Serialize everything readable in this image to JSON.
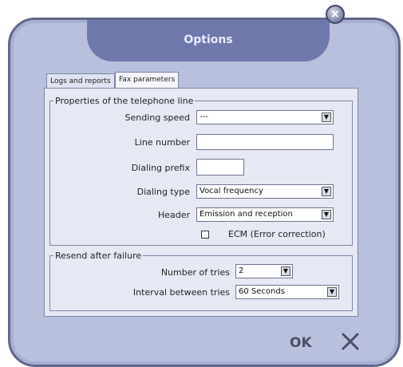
{
  "window": {
    "title": "Options",
    "close_icon": "close-icon"
  },
  "tabs": [
    {
      "label": "Logs and reports"
    },
    {
      "label": "Fax parameters",
      "active": true
    }
  ],
  "telephone_line": {
    "legend": "Properties of the telephone line",
    "sending_speed": {
      "label": "Sending speed",
      "value": "---"
    },
    "line_number": {
      "label": "Line number",
      "value": ""
    },
    "dialing_prefix": {
      "label": "Dialing prefix",
      "value": ""
    },
    "dialing_type": {
      "label": "Dialing type",
      "value": "Vocal frequency"
    },
    "header": {
      "label": "Header",
      "value": "Emission and reception"
    },
    "ecm": {
      "label": "ECM (Error correction)",
      "checked": false
    }
  },
  "resend": {
    "legend": "Resend after failure",
    "tries": {
      "label": "Number of tries",
      "value": "2"
    },
    "interval": {
      "label": "Interval between tries",
      "value": "60 Seconds"
    }
  },
  "buttons": {
    "ok_label": "OK",
    "cancel_icon": "cancel-x-icon"
  }
}
